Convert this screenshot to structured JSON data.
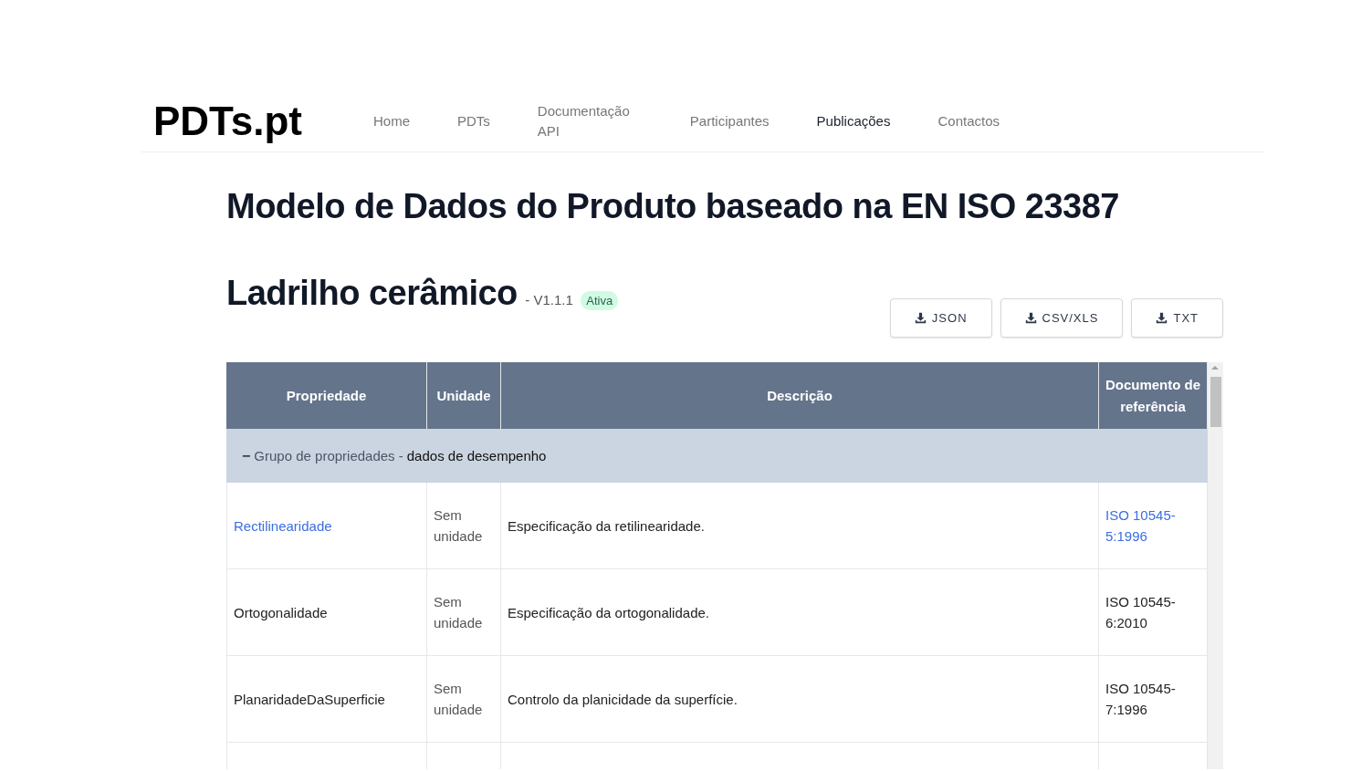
{
  "site": {
    "logo": "PDTs.pt",
    "nav": [
      {
        "label": "Home",
        "selected": false
      },
      {
        "label": "PDTs",
        "selected": false
      },
      {
        "label": "Documentação API",
        "selected": false
      },
      {
        "label": "Participantes",
        "selected": false
      },
      {
        "label": "Publicações",
        "selected": true
      },
      {
        "label": "Contactos",
        "selected": false
      }
    ]
  },
  "page_title": "Modelo de Dados do Produto baseado na EN ISO 23387",
  "template": {
    "name": "Ladrilho cerâmico",
    "version": "- V1.1.1",
    "status": "Ativa"
  },
  "downloads": [
    "JSON",
    "CSV/XLS",
    "TXT"
  ],
  "table": {
    "columns": [
      "Propriedade",
      "Unidade",
      "Descrição",
      "Documento de referência"
    ],
    "group": {
      "toggle": "−",
      "label": "Grupo de propriedades -",
      "name": "dados de desempenho",
      "expanded": true
    },
    "rows": [
      {
        "property": "Rectilinearidade",
        "property_link": true,
        "unit": "Sem unidade",
        "description": "Especificação da retilinearidade.",
        "reference": "ISO 10545-5:1996",
        "reference_link": true
      },
      {
        "property": "Ortogonalidade",
        "property_link": false,
        "unit": "Sem unidade",
        "description": "Especificação da ortogonalidade.",
        "reference": "ISO 10545-6:2010",
        "reference_link": false
      },
      {
        "property": "PlanaridadeDaSuperficie",
        "property_link": false,
        "unit": "Sem unidade",
        "description": "Controlo da planicidade da superfície.",
        "reference": "ISO 10545-7:1996",
        "reference_link": false
      }
    ]
  }
}
